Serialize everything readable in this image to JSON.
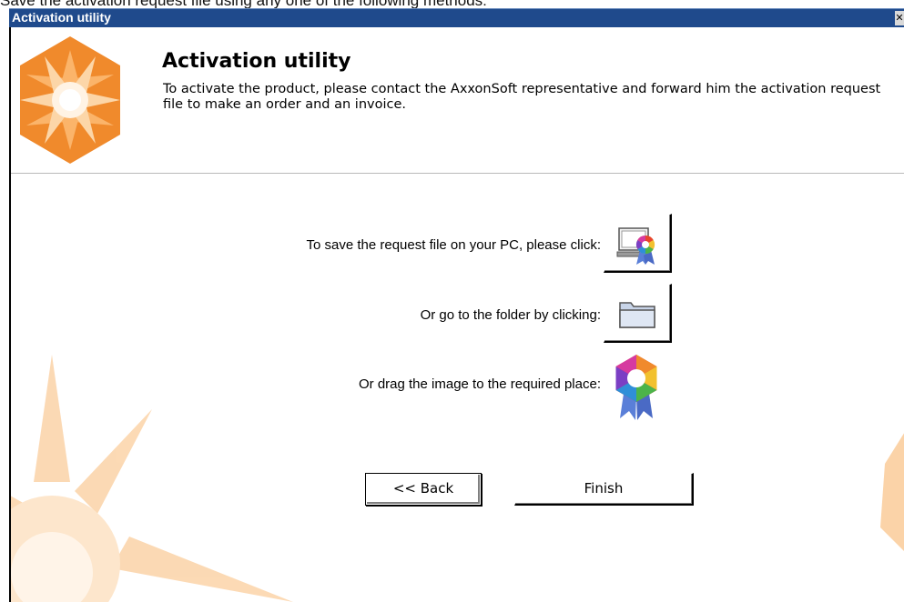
{
  "caption": "Save the activation request file using any one of the following methods:",
  "window": {
    "title": "Activation utility",
    "close_symbol": "✕"
  },
  "header": {
    "title": "Activation utility",
    "description": "To activate the product, please contact the AxxonSoft representative and forward him the activation request file to make an order and an invoice."
  },
  "methods": {
    "save_label": "To save the request file on your PC, please click:",
    "folder_label": "Or go to the folder by clicking:",
    "drag_label": "Or drag the image to the required place:"
  },
  "icons": {
    "save": "computer-with-badge-icon",
    "folder": "folder-icon",
    "drag": "activation-request-badge-icon"
  },
  "buttons": {
    "back": "<< Back",
    "finish": "Finish"
  },
  "colors": {
    "titlebar": "#1f4a8c",
    "logo_orange": "#f08a2c",
    "accent_star": "#fbd3a8"
  }
}
